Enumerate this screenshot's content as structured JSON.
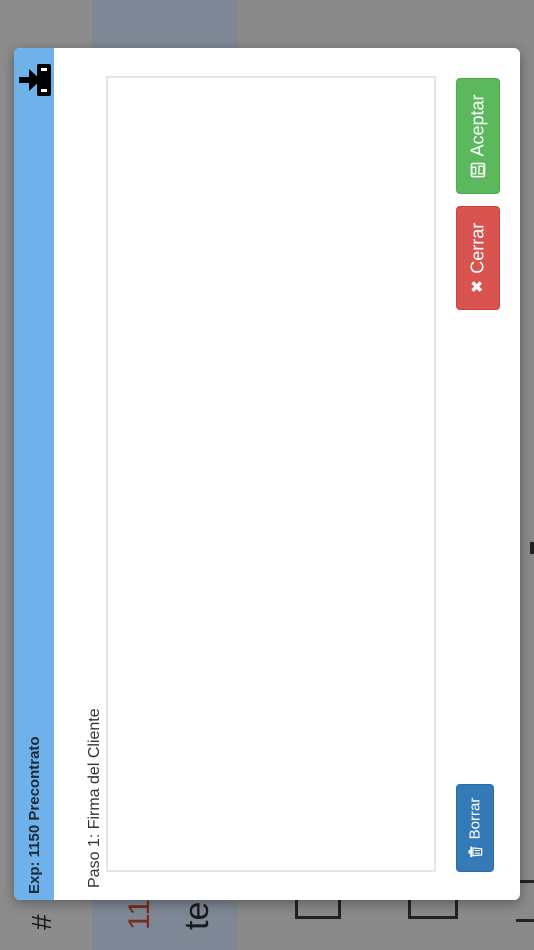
{
  "modal": {
    "title": "Exp: 1150 Precontrato",
    "step_label": "Paso 1: Firma del Cliente",
    "buttons": {
      "accept_label": "Aceptar",
      "close_label": "Cerrar",
      "clear_label": "Borrar"
    },
    "icons": {
      "exit": "sign-in-icon",
      "accept": "save-icon",
      "close": "times-icon",
      "clear": "trash-icon"
    }
  },
  "background": {
    "hash": "#",
    "number": "11",
    "text": "te"
  },
  "colors": {
    "header": "#6fb1ea",
    "accept": "#5cb85c",
    "close": "#d9534f",
    "clear": "#337ab7"
  }
}
